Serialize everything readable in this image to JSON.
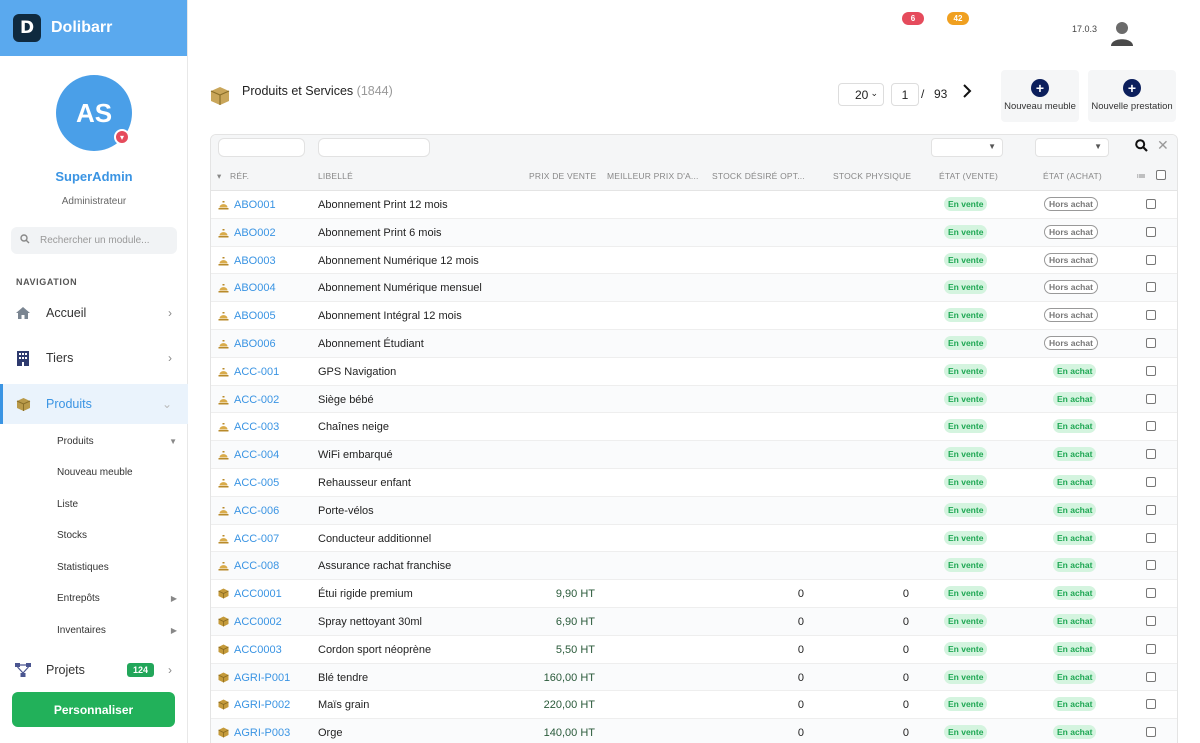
{
  "brand": {
    "name": "Dolibarr",
    "logo_letter": "D"
  },
  "user": {
    "initials": "AS",
    "name": "SuperAdmin",
    "role": "Administrateur"
  },
  "search_module": {
    "placeholder": "Rechercher un module..."
  },
  "nav": {
    "title": "NAVIGATION",
    "items": [
      {
        "label": "Accueil"
      },
      {
        "label": "Tiers"
      },
      {
        "label": "Produits"
      },
      {
        "label": "Projets",
        "badge": "124"
      }
    ],
    "sub_items": [
      {
        "label": "Produits"
      },
      {
        "label": "Nouveau meuble"
      },
      {
        "label": "Liste"
      },
      {
        "label": "Stocks"
      },
      {
        "label": "Statistiques"
      },
      {
        "label": "Entrepôts"
      },
      {
        "label": "Inventaires"
      }
    ],
    "customize": "Personnaliser"
  },
  "topbar": {
    "badge_red": "6",
    "badge_orange": "42",
    "version": "17.0.3"
  },
  "header": {
    "title": "Produits et Services",
    "count": "(1844)",
    "per_page": "20",
    "page": "1",
    "sep": "/",
    "total_pages": "93",
    "btn_new_furniture": "Nouveau meuble",
    "btn_new_service": "Nouvelle prestation"
  },
  "table": {
    "headers": {
      "ref": "RÉF.",
      "label": "LIBELLÉ",
      "price": "PRIX DE VENTE",
      "best_price": "MEILLEUR PRIX D'A...",
      "stock_desired": "STOCK DÉSIRÉ OPT...",
      "stock_physical": "STOCK PHYSIQUE",
      "status_sell": "ÉTAT (VENTE)",
      "status_buy": "ÉTAT (ACHAT)"
    },
    "rows": [
      {
        "ref": "ABO001",
        "label": "Abonnement Print 12 mois",
        "price": "",
        "stock_desired": "",
        "stock_physical": "",
        "sell": "En vente",
        "buy": "Hors achat",
        "kind": "service"
      },
      {
        "ref": "ABO002",
        "label": "Abonnement Print 6 mois",
        "price": "",
        "stock_desired": "",
        "stock_physical": "",
        "sell": "En vente",
        "buy": "Hors achat",
        "kind": "service"
      },
      {
        "ref": "ABO003",
        "label": "Abonnement Numérique 12 mois",
        "price": "",
        "stock_desired": "",
        "stock_physical": "",
        "sell": "En vente",
        "buy": "Hors achat",
        "kind": "service"
      },
      {
        "ref": "ABO004",
        "label": "Abonnement Numérique mensuel",
        "price": "",
        "stock_desired": "",
        "stock_physical": "",
        "sell": "En vente",
        "buy": "Hors achat",
        "kind": "service"
      },
      {
        "ref": "ABO005",
        "label": "Abonnement Intégral 12 mois",
        "price": "",
        "stock_desired": "",
        "stock_physical": "",
        "sell": "En vente",
        "buy": "Hors achat",
        "kind": "service"
      },
      {
        "ref": "ABO006",
        "label": "Abonnement Étudiant",
        "price": "",
        "stock_desired": "",
        "stock_physical": "",
        "sell": "En vente",
        "buy": "Hors achat",
        "kind": "service"
      },
      {
        "ref": "ACC-001",
        "label": "GPS Navigation",
        "price": "",
        "stock_desired": "",
        "stock_physical": "",
        "sell": "En vente",
        "buy": "En achat",
        "kind": "service"
      },
      {
        "ref": "ACC-002",
        "label": "Siège bébé",
        "price": "",
        "stock_desired": "",
        "stock_physical": "",
        "sell": "En vente",
        "buy": "En achat",
        "kind": "service"
      },
      {
        "ref": "ACC-003",
        "label": "Chaînes neige",
        "price": "",
        "stock_desired": "",
        "stock_physical": "",
        "sell": "En vente",
        "buy": "En achat",
        "kind": "service"
      },
      {
        "ref": "ACC-004",
        "label": "WiFi embarqué",
        "price": "",
        "stock_desired": "",
        "stock_physical": "",
        "sell": "En vente",
        "buy": "En achat",
        "kind": "service"
      },
      {
        "ref": "ACC-005",
        "label": "Rehausseur enfant",
        "price": "",
        "stock_desired": "",
        "stock_physical": "",
        "sell": "En vente",
        "buy": "En achat",
        "kind": "service"
      },
      {
        "ref": "ACC-006",
        "label": "Porte-vélos",
        "price": "",
        "stock_desired": "",
        "stock_physical": "",
        "sell": "En vente",
        "buy": "En achat",
        "kind": "service"
      },
      {
        "ref": "ACC-007",
        "label": "Conducteur additionnel",
        "price": "",
        "stock_desired": "",
        "stock_physical": "",
        "sell": "En vente",
        "buy": "En achat",
        "kind": "service"
      },
      {
        "ref": "ACC-008",
        "label": "Assurance rachat franchise",
        "price": "",
        "stock_desired": "",
        "stock_physical": "",
        "sell": "En vente",
        "buy": "En achat",
        "kind": "service"
      },
      {
        "ref": "ACC0001",
        "label": "Étui rigide premium",
        "price": "9,90 HT",
        "stock_desired": "0",
        "stock_physical": "0",
        "sell": "En vente",
        "buy": "En achat",
        "kind": "product"
      },
      {
        "ref": "ACC0002",
        "label": "Spray nettoyant 30ml",
        "price": "6,90 HT",
        "stock_desired": "0",
        "stock_physical": "0",
        "sell": "En vente",
        "buy": "En achat",
        "kind": "product"
      },
      {
        "ref": "ACC0003",
        "label": "Cordon sport néoprène",
        "price": "5,50 HT",
        "stock_desired": "0",
        "stock_physical": "0",
        "sell": "En vente",
        "buy": "En achat",
        "kind": "product"
      },
      {
        "ref": "AGRI-P001",
        "label": "Blé tendre",
        "price": "160,00 HT",
        "stock_desired": "0",
        "stock_physical": "0",
        "sell": "En vente",
        "buy": "En achat",
        "kind": "product"
      },
      {
        "ref": "AGRI-P002",
        "label": "Maïs grain",
        "price": "220,00 HT",
        "stock_desired": "0",
        "stock_physical": "0",
        "sell": "En vente",
        "buy": "En achat",
        "kind": "product"
      },
      {
        "ref": "AGRI-P003",
        "label": "Orge",
        "price": "140,00 HT",
        "stock_desired": "0",
        "stock_physical": "0",
        "sell": "En vente",
        "buy": "En achat",
        "kind": "product"
      }
    ]
  },
  "colors": {
    "accent": "#3a94e3",
    "brand_bar": "#5aa9ee",
    "green": "#22b15a",
    "badge_red": "#e54b5c",
    "badge_orange": "#f0a020"
  }
}
